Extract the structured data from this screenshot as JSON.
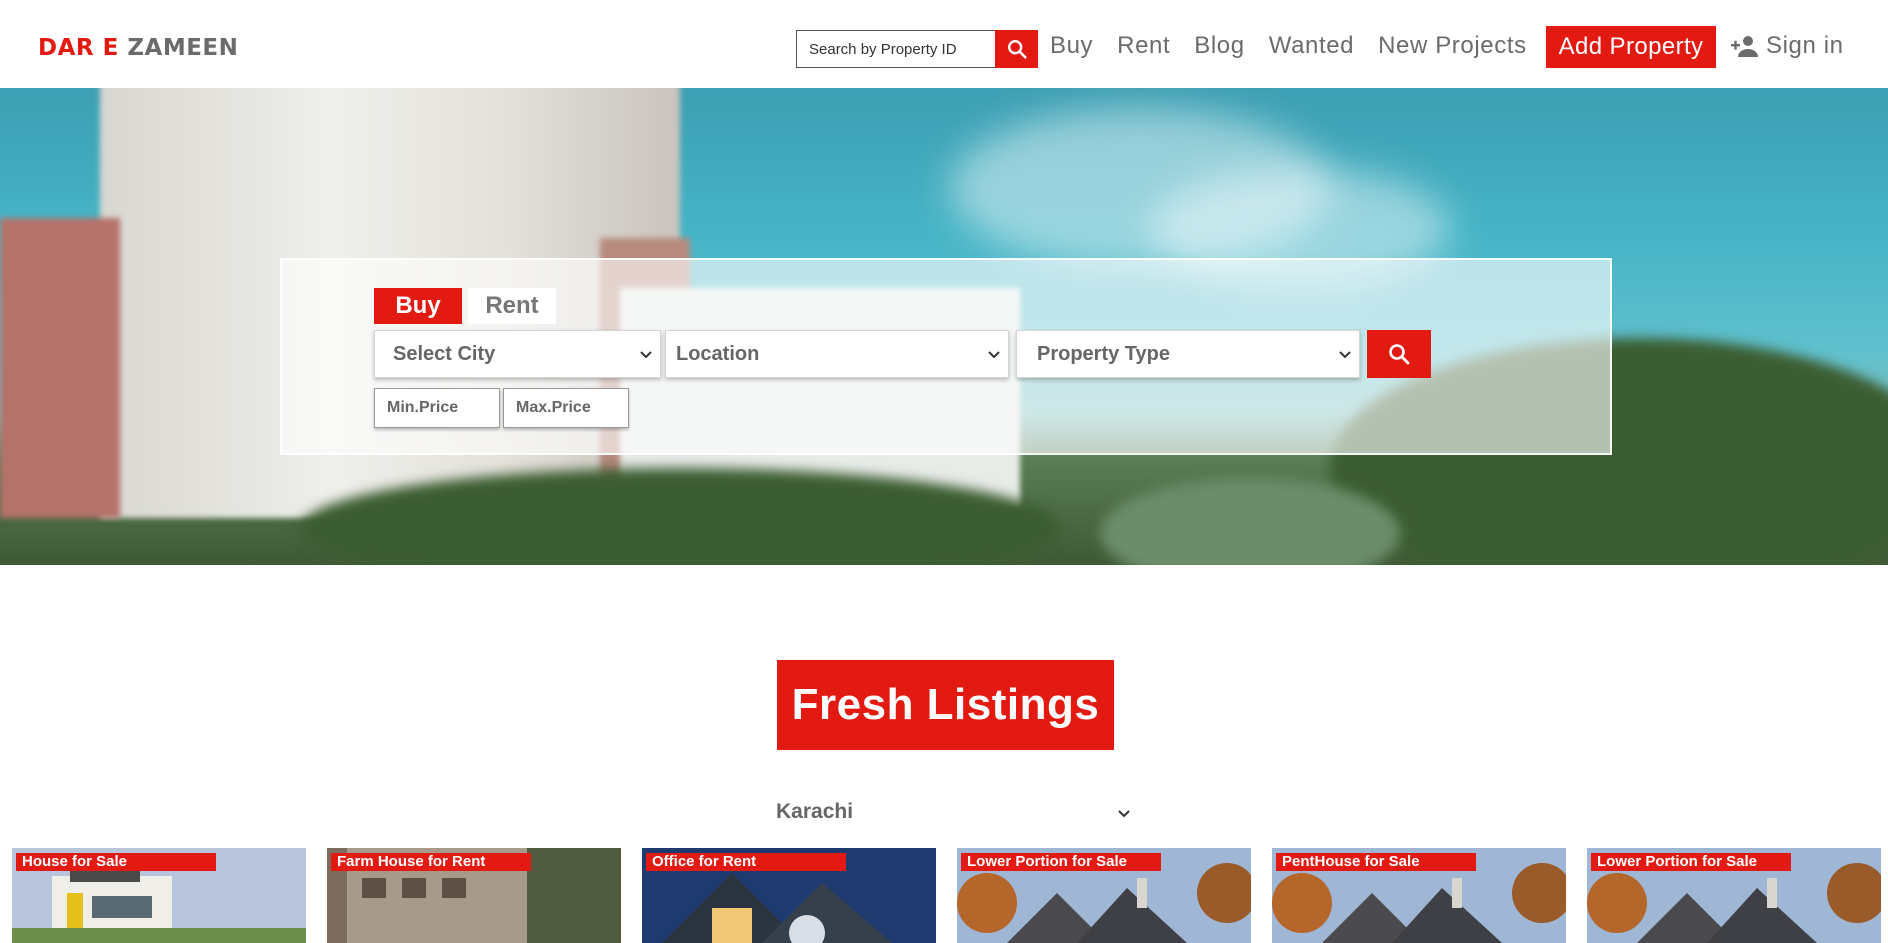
{
  "brand": {
    "part1": "DAR E",
    "part2": "ZAMEEN"
  },
  "header": {
    "search_placeholder": "Search by Property ID",
    "nav": [
      "Buy",
      "Rent",
      "Blog",
      "Wanted",
      "New Projects"
    ],
    "add_property": "Add Property",
    "sign_in": "Sign in"
  },
  "hero": {
    "tabs": {
      "buy": "Buy",
      "rent": "Rent"
    },
    "selects": {
      "city": "Select City",
      "location": "Location",
      "property_type": "Property Type"
    },
    "price": {
      "min_placeholder": "Min.Price",
      "max_placeholder": "Max.Price"
    }
  },
  "listings": {
    "title": "Fresh Listings",
    "city": "Karachi",
    "cards": [
      {
        "label": "House for Sale"
      },
      {
        "label": "Farm House for Rent"
      },
      {
        "label": "Office for Rent"
      },
      {
        "label": "Lower Portion for Sale"
      },
      {
        "label": "PentHouse for Sale"
      },
      {
        "label": "Lower Portion for Sale"
      }
    ]
  },
  "colors": {
    "accent": "#e31a12",
    "text_grey": "#6b6b6b"
  }
}
